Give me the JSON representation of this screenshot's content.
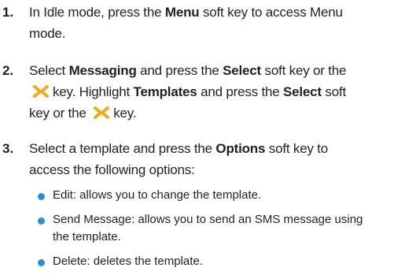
{
  "steps": [
    {
      "number": "1.",
      "lines": [
        [
          {
            "t": "In Idle mode, press the "
          },
          {
            "b": "Menu"
          },
          {
            "t": " soft key to access Menu"
          }
        ],
        [
          {
            "t": "mode."
          }
        ]
      ]
    },
    {
      "number": "2.",
      "lines": [
        [
          {
            "t": "Select "
          },
          {
            "b": "Messaging"
          },
          {
            "t": " and press the "
          },
          {
            "b": "Select"
          },
          {
            "t": " soft key or the"
          }
        ],
        [
          {
            "icon": "x-key-icon"
          },
          {
            "t": "key. Highlight "
          },
          {
            "b": "Templates"
          },
          {
            "t": " and press the "
          },
          {
            "b": "Select"
          },
          {
            "t": " soft"
          }
        ],
        [
          {
            "t": "key or the "
          },
          {
            "icon": "x-key-icon"
          },
          {
            "t": "key."
          }
        ]
      ]
    },
    {
      "number": "3.",
      "lines": [
        [
          {
            "t": "Select a template and press the "
          },
          {
            "b": "Options"
          },
          {
            "t": " soft key to"
          }
        ],
        [
          {
            "t": "access the following options:"
          }
        ]
      ]
    }
  ],
  "bullets": [
    {
      "lines": [
        "Edit: allows you to change the template."
      ]
    },
    {
      "lines": [
        "Send Message: allows you to send an SMS message using",
        "the template."
      ]
    },
    {
      "lines": [
        "Delete: deletes the template."
      ]
    }
  ],
  "colors": {
    "bullet": "#2c8dd6",
    "key_icon": "#f4a81d",
    "text": "#231f20"
  }
}
